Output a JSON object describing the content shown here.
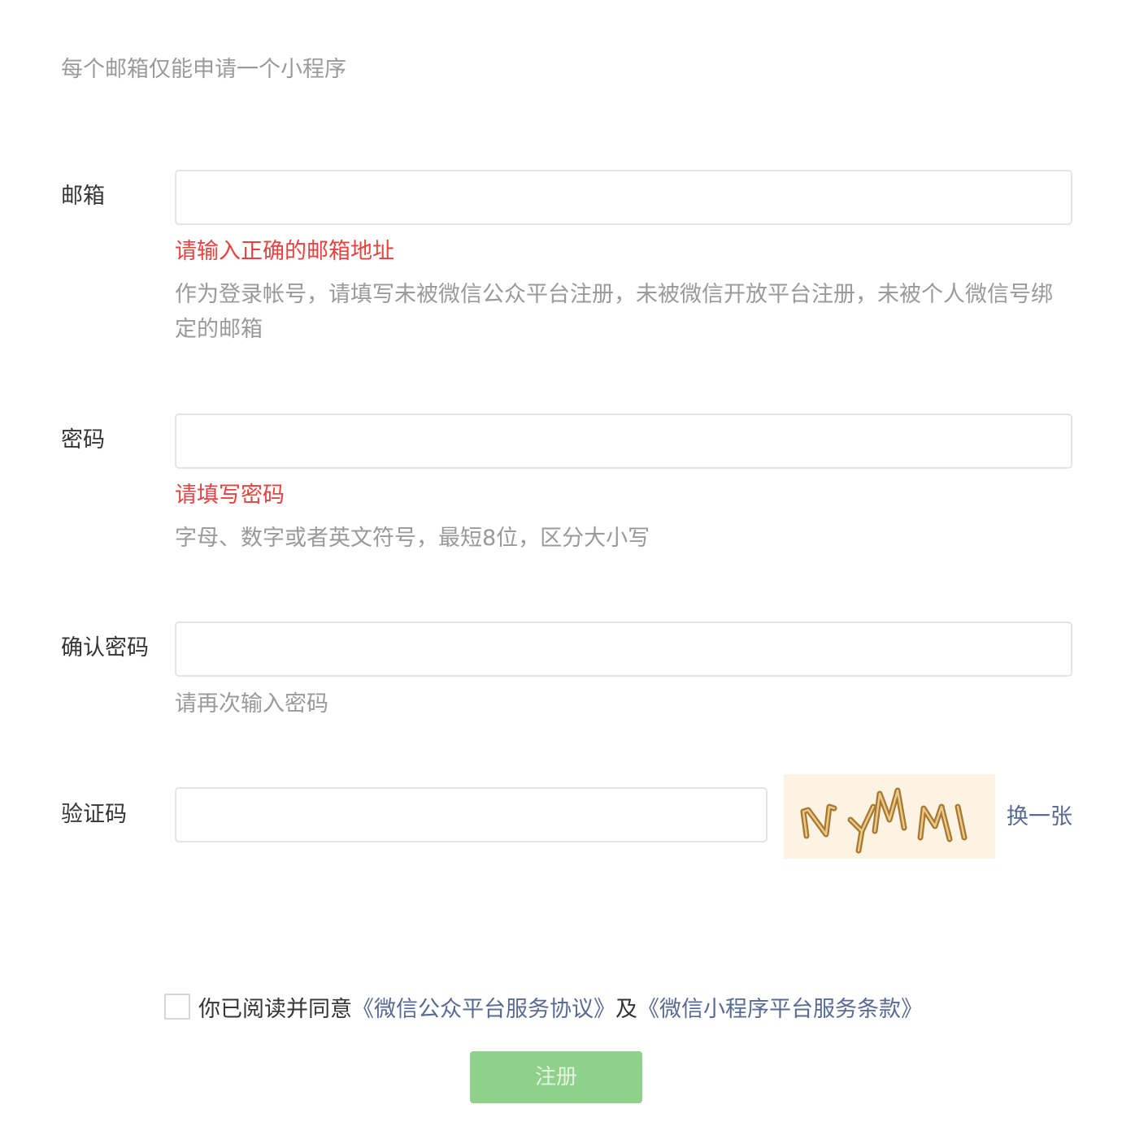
{
  "notice": "每个邮箱仅能申请一个小程序",
  "email": {
    "label": "邮箱",
    "value": "",
    "error": "请输入正确的邮箱地址",
    "tip": "作为登录帐号，请填写未被微信公众平台注册，未被微信开放平台注册，未被个人微信号绑定的邮箱"
  },
  "password": {
    "label": "密码",
    "value": "",
    "error": "请填写密码",
    "tip": "字母、数字或者英文符号，最短8位，区分大小写"
  },
  "confirm_password": {
    "label": "确认密码",
    "value": "",
    "tip": "请再次输入密码"
  },
  "captcha": {
    "label": "验证码",
    "value": "",
    "image_text": "NYMM",
    "refresh_label": "换一张"
  },
  "agreement": {
    "checked": false,
    "prefix": "你已阅读并同意",
    "link1": "《微信公众平台服务协议》",
    "conjunction": "及",
    "link2": "《微信小程序平台服务条款》"
  },
  "submit": {
    "label": "注册",
    "enabled": false
  },
  "colors": {
    "link": "#576b95",
    "error": "#e64340",
    "button_disabled": "#8fd18a"
  }
}
